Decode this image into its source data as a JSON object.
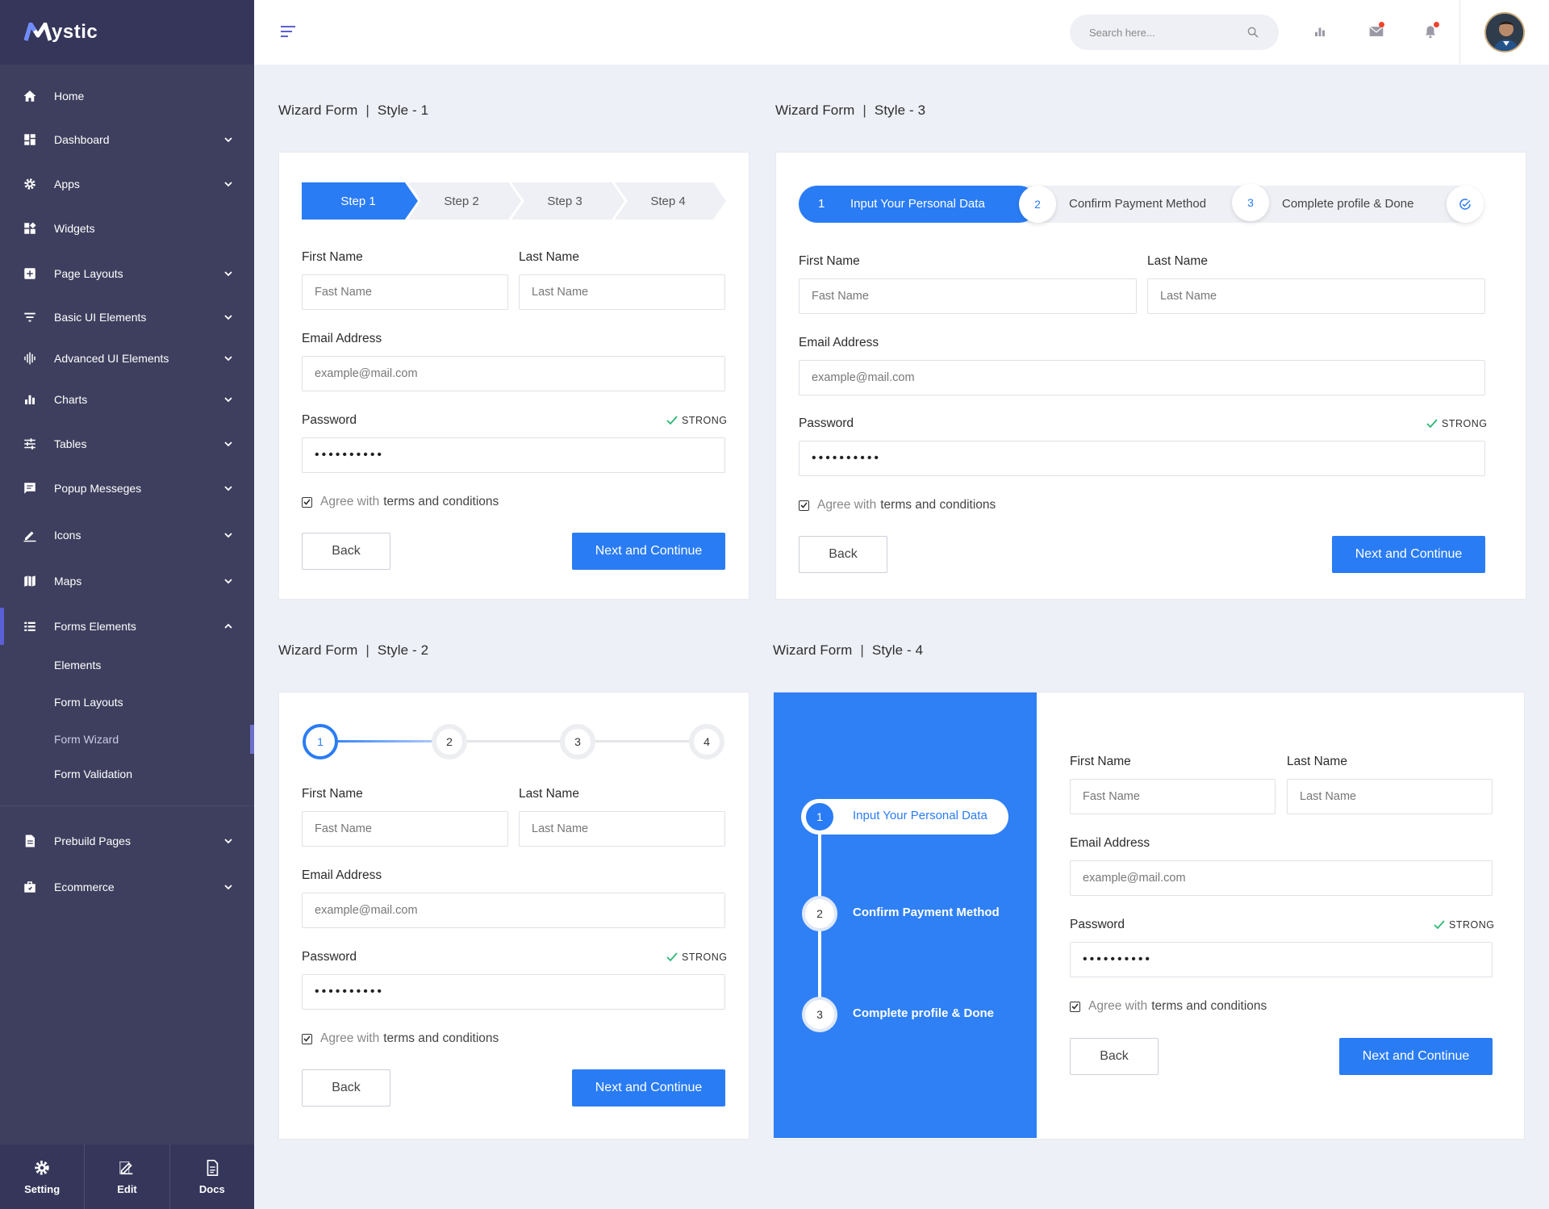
{
  "brand": {
    "logo_mark": "M",
    "logo_text": "ystic"
  },
  "sidebar": {
    "items": [
      {
        "label": "Home",
        "icon": "home-icon"
      },
      {
        "label": "Dashboard",
        "icon": "dashboard-icon"
      },
      {
        "label": "Apps",
        "icon": "gear-icon"
      },
      {
        "label": "Widgets",
        "icon": "widgets-icon"
      },
      {
        "label": "Page Layouts",
        "icon": "layout-icon"
      },
      {
        "label": "Basic UI Elements",
        "icon": "filter-icon"
      },
      {
        "label": "Advanced UI Elements",
        "icon": "equalizer-icon"
      },
      {
        "label": "Charts",
        "icon": "bar-chart-icon"
      },
      {
        "label": "Tables",
        "icon": "sliders-icon"
      },
      {
        "label": "Popup Messeges",
        "icon": "message-icon"
      },
      {
        "label": "Icons",
        "icon": "pencil-icon"
      },
      {
        "label": "Maps",
        "icon": "map-icon"
      },
      {
        "label": "Forms Elements",
        "icon": "list-icon"
      }
    ],
    "sub_items": [
      "Elements",
      "Form Layouts",
      "Form Wizard",
      "Form Validation"
    ],
    "bottom_items": [
      {
        "label": "Prebuild Pages",
        "icon": "page-icon"
      },
      {
        "label": "Ecommerce",
        "icon": "bag-icon"
      }
    ],
    "footer": [
      {
        "label": "Setting",
        "icon": "gear-icon"
      },
      {
        "label": "Edit",
        "icon": "edit-icon"
      },
      {
        "label": "Docs",
        "icon": "doc-icon"
      }
    ]
  },
  "header": {
    "search_placeholder": "Search here..."
  },
  "colors": {
    "accent": "#2a7cf4",
    "sidebar": "#3e3f5e",
    "page_bg": "#eef0f7",
    "notify": "#f0432c"
  },
  "form": {
    "first_name_label": "First Name",
    "last_name_label": "Last Name",
    "first_name_placeholder": "Fast Name",
    "last_name_placeholder": "Last Name",
    "email_label": "Email Address",
    "email_placeholder": "example@mail.com",
    "password_label": "Password",
    "password_value": "••••••••••",
    "strength": "STRONG",
    "agree_prefix": "Agree with",
    "agree_terms": "terms and conditions",
    "back": "Back",
    "next": "Next and Continue"
  },
  "wizard1": {
    "title": "Wizard Form",
    "style": "Style - 1",
    "steps": [
      "Step 1",
      "Step 2",
      "Step 3",
      "Step 4"
    ]
  },
  "wizard2": {
    "title": "Wizard Form",
    "style": "Style - 2",
    "steps": [
      "1",
      "2",
      "3",
      "4"
    ]
  },
  "wizard3": {
    "title": "Wizard Form",
    "style": "Style - 3",
    "steps": [
      {
        "num": "1",
        "label": "Input Your Personal Data"
      },
      {
        "num": "2",
        "label": "Confirm Payment Method"
      },
      {
        "num": "3",
        "label": "Complete profile & Done"
      }
    ]
  },
  "wizard4": {
    "title": "Wizard Form",
    "style": "Style - 4",
    "steps": [
      {
        "num": "1",
        "label": "Input Your Personal Data"
      },
      {
        "num": "2",
        "label": "Confirm Payment Method"
      },
      {
        "num": "3",
        "label": "Complete profile & Done"
      }
    ]
  }
}
